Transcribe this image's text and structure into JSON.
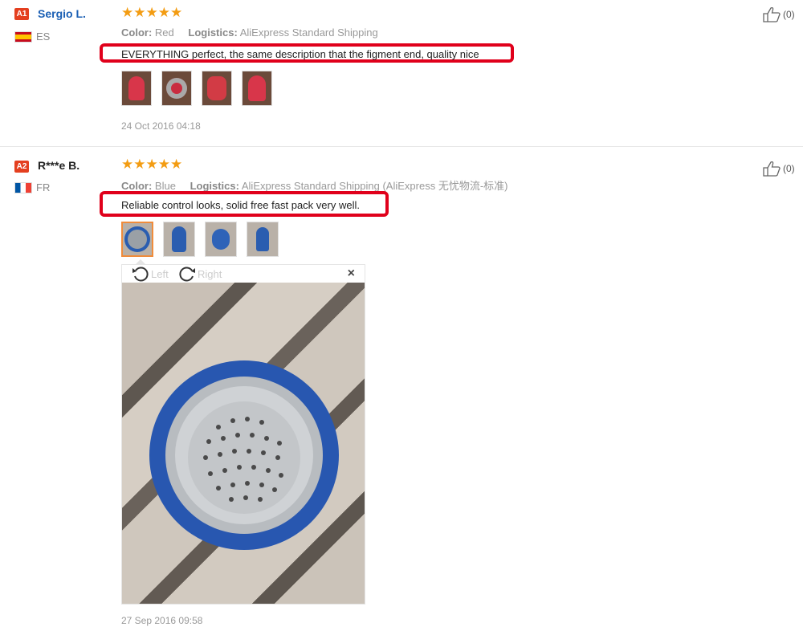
{
  "reviews": [
    {
      "badge": "A1",
      "name": "Sergio L.",
      "country": "ES",
      "stars": "★★★★★",
      "color_label": "Color:",
      "color_value": "Red",
      "logistics_label": "Logistics:",
      "logistics_value": "AliExpress Standard Shipping",
      "text": "EVERYTHING perfect, the same description that the figment end, quality nice",
      "date": "24 Oct 2016 04:18",
      "likes": "(0)"
    },
    {
      "badge": "A2",
      "name": "R***e B.",
      "country": "FR",
      "stars": "★★★★★",
      "color_label": "Color:",
      "color_value": "Blue",
      "logistics_label": "Logistics:",
      "logistics_value": "AliExpress Standard Shipping (AliExpress 无忧物流-标准)",
      "text": "Reliable control looks, solid free fast pack very well.",
      "date": "27 Sep 2016 09:58",
      "likes": "(0)"
    }
  ],
  "viewer": {
    "rotate_left": "Left",
    "rotate_right": "Right",
    "close": "×"
  },
  "colors": {
    "badge": "#e43f1f",
    "stars": "#f39c12",
    "highlight": "#e0001b",
    "link": "#1a5fb4"
  }
}
